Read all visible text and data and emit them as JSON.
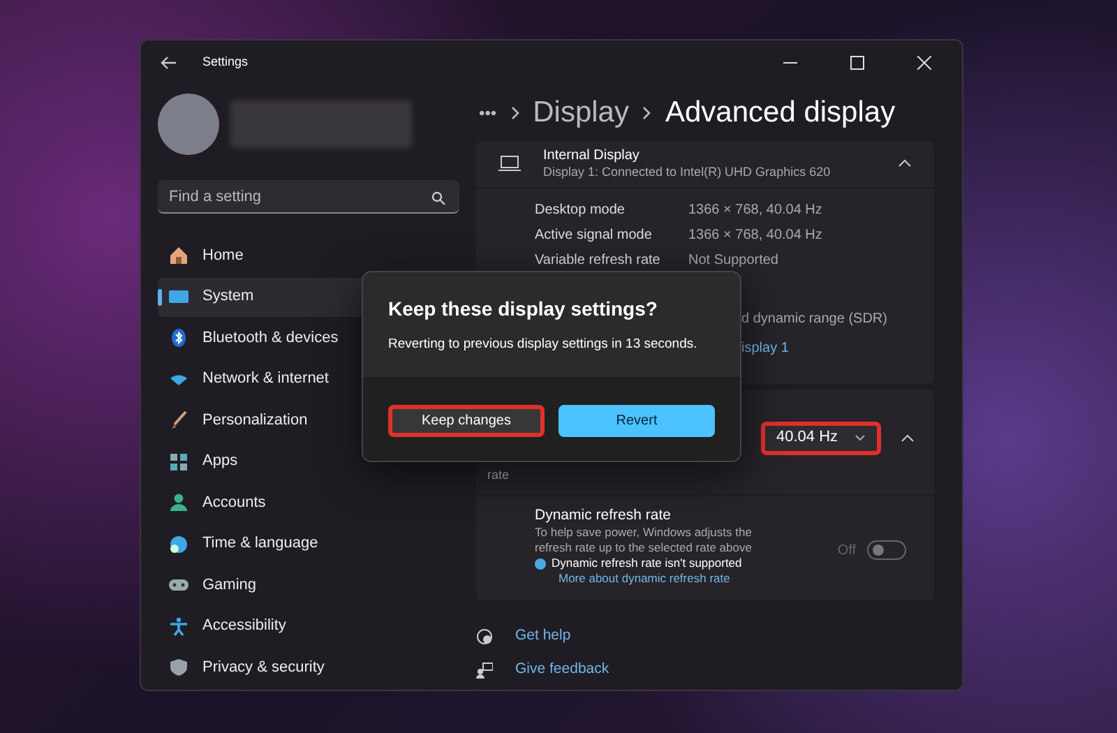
{
  "window": {
    "title": "Settings"
  },
  "sidebar": {
    "search": {
      "placeholder": "Find a setting"
    },
    "items": [
      {
        "label": "Home",
        "selected": false
      },
      {
        "label": "System",
        "selected": true
      },
      {
        "label": "Bluetooth & devices",
        "selected": false
      },
      {
        "label": "Network & internet",
        "selected": false
      },
      {
        "label": "Personalization",
        "selected": false
      },
      {
        "label": "Apps",
        "selected": false
      },
      {
        "label": "Accounts",
        "selected": false
      },
      {
        "label": "Time & language",
        "selected": false
      },
      {
        "label": "Gaming",
        "selected": false
      },
      {
        "label": "Accessibility",
        "selected": false
      },
      {
        "label": "Privacy & security",
        "selected": false
      }
    ]
  },
  "breadcrumb": {
    "more": "•••",
    "items": [
      "Display",
      "Advanced display"
    ]
  },
  "display_card": {
    "title": "Internal Display",
    "subtitle": "Display 1: Connected to Intel(R) UHD Graphics 620",
    "expanded": true,
    "rows": [
      {
        "label": "Desktop mode",
        "value": "1366 × 768, 40.04 Hz"
      },
      {
        "label": "Active signal mode",
        "value": "1366 × 768, 40.04 Hz"
      },
      {
        "label": "Variable refresh rate",
        "value": "Not Supported"
      }
    ],
    "partial_texts": [
      {
        "text": "d dynamic range (SDR)",
        "kind": "plain"
      },
      {
        "text": "isplay 1",
        "kind": "link"
      }
    ]
  },
  "refresh_card": {
    "label": "rate",
    "dropdown": {
      "value": "40.04 Hz",
      "highlighted": true
    },
    "expanded": true,
    "dynamic": {
      "title": "Dynamic refresh rate",
      "description": "To help save power, Windows adjusts the refresh rate up to the selected rate above",
      "notice": "Dynamic refresh rate isn't supported",
      "link": "More about dynamic refresh rate",
      "toggle_label": "Off",
      "on": false,
      "disabled": true
    }
  },
  "footer_links": [
    "Get help",
    "Give feedback"
  ],
  "dialog": {
    "title": "Keep these display settings?",
    "message": "Reverting to previous display settings in 13 seconds.",
    "buttons": [
      {
        "label": "Keep changes",
        "kind": "secondary",
        "highlighted": true
      },
      {
        "label": "Revert",
        "kind": "primary",
        "highlighted": false
      }
    ]
  }
}
